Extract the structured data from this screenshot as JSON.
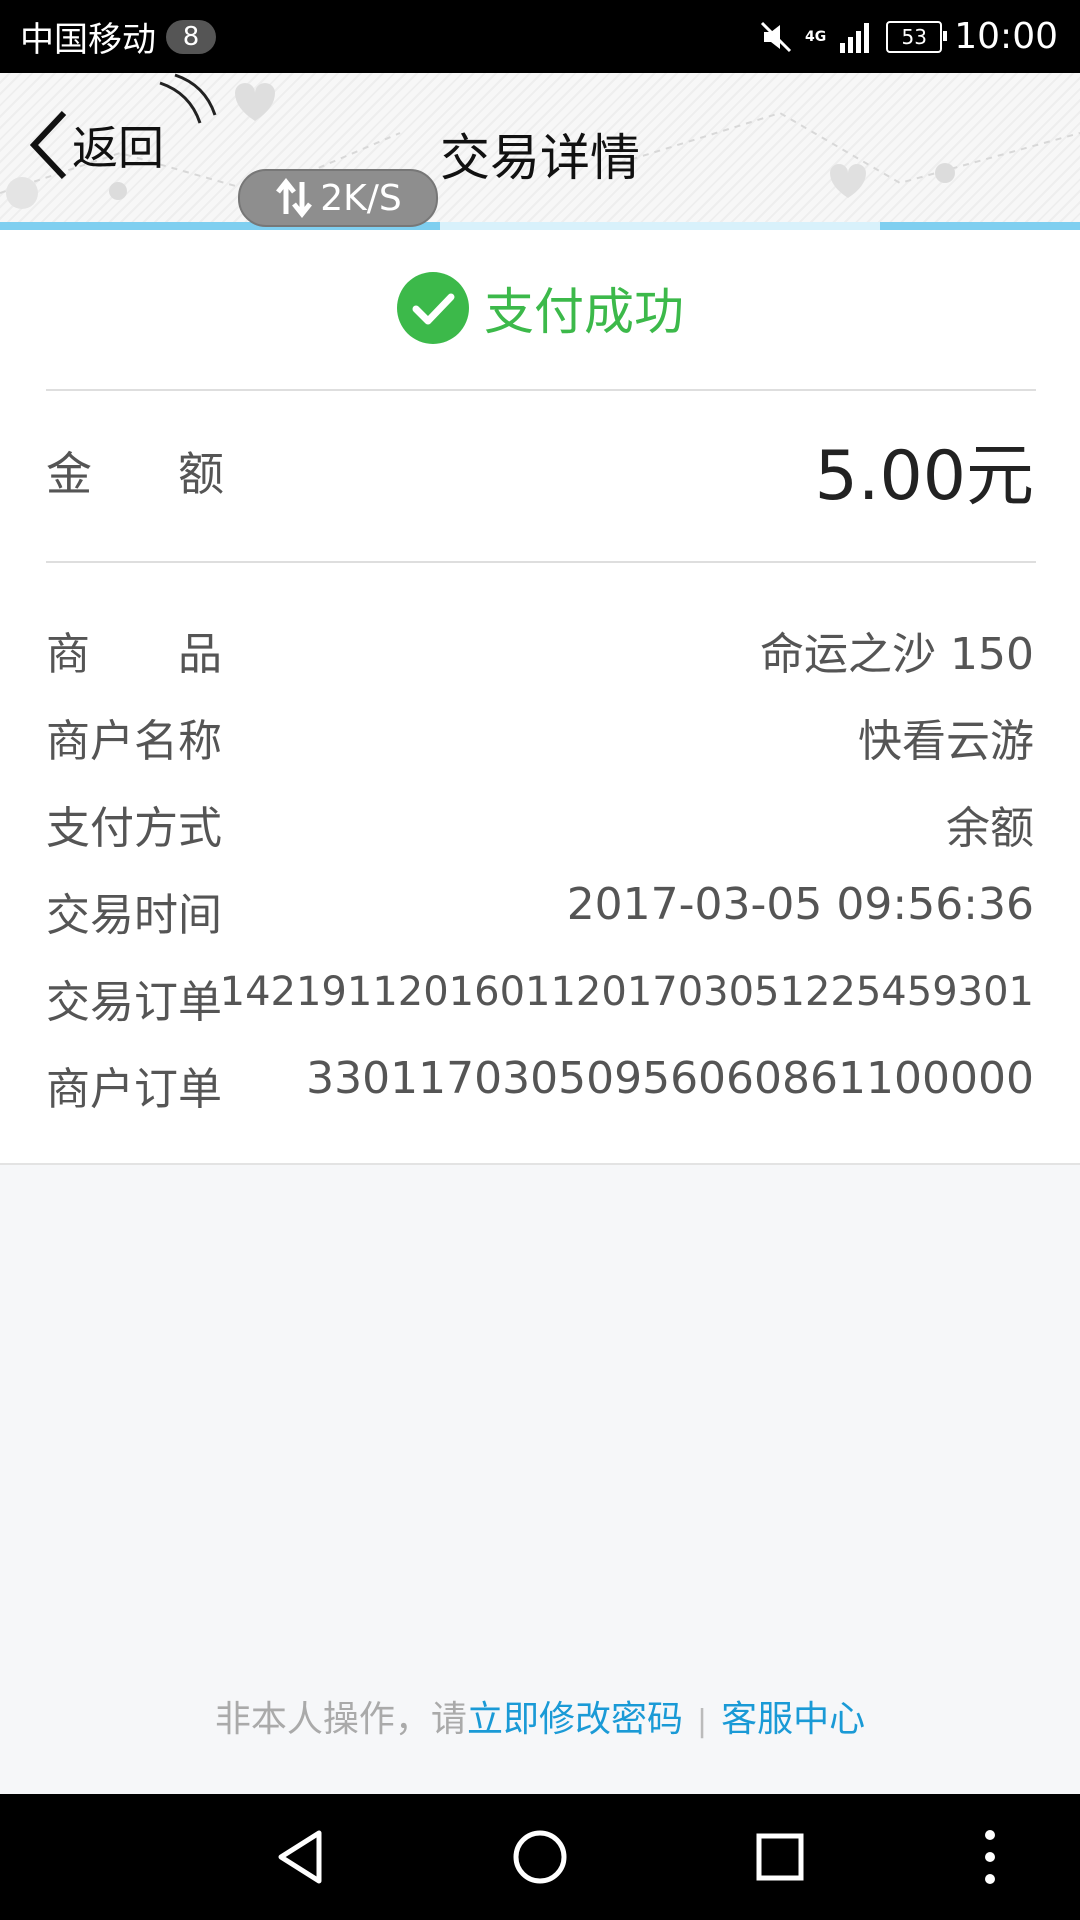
{
  "status_bar": {
    "carrier": "中国移动",
    "notification_count": "8",
    "network_type": "4G",
    "battery_level": "53",
    "time": "10:00"
  },
  "header": {
    "back_label": "返回",
    "title": "交易详情",
    "speed_indicator": "2K/S"
  },
  "payment": {
    "status_text": "支付成功",
    "status_color": "#3cb94a",
    "amount_label": "金额",
    "amount_value": "5.00元",
    "details": [
      {
        "label": "商品",
        "value": "命运之沙 150"
      },
      {
        "label": "商户名称",
        "value": "快看云游"
      },
      {
        "label": "支付方式",
        "value": "余额"
      },
      {
        "label": "交易时间",
        "value": "2017-03-05 09:56:36"
      },
      {
        "label": "交易订单",
        "value": "1421911201601120170305122545930​1"
      },
      {
        "label": "商户订单",
        "value": "330117030509560608611000​00"
      }
    ]
  },
  "footer": {
    "prefix": "非本人操作，请",
    "change_password_link": "立即修改密码",
    "separator": "|",
    "support_link": "客服中心",
    "link_color": "#1a9ad6"
  },
  "nav_bar": {
    "icons": [
      "back-triangle-icon",
      "home-circle-icon",
      "recents-square-icon",
      "more-dots-icon"
    ]
  }
}
